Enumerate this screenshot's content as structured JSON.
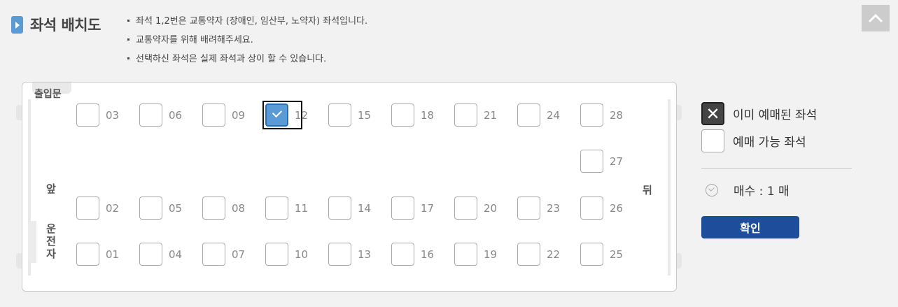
{
  "header": {
    "title": "좌석 배치도",
    "notices": [
      "좌석 1,2번은 교통약자 (장애인, 임산부, 노약자) 좌석입니다.",
      "교통약자를 위해 배려해주세요.",
      "선택하신 좌석은 실제 좌석과 상이 할 수 있습니다."
    ],
    "top_button_icon": "chevron-up-icon"
  },
  "bus": {
    "entrance_label": "출입문",
    "front_label": "앞",
    "back_label": "뒤",
    "driver_label": "운전자",
    "seats": [
      {
        "num": "03",
        "state": "available"
      },
      {
        "num": "06",
        "state": "available"
      },
      {
        "num": "09",
        "state": "available"
      },
      {
        "num": "12",
        "state": "selected"
      },
      {
        "num": "15",
        "state": "available"
      },
      {
        "num": "18",
        "state": "available"
      },
      {
        "num": "21",
        "state": "available"
      },
      {
        "num": "24",
        "state": "available"
      },
      {
        "num": "28",
        "state": "available"
      },
      {
        "num": "27",
        "state": "available"
      },
      {
        "num": "02",
        "state": "available"
      },
      {
        "num": "05",
        "state": "available"
      },
      {
        "num": "08",
        "state": "available"
      },
      {
        "num": "11",
        "state": "available"
      },
      {
        "num": "14",
        "state": "available"
      },
      {
        "num": "17",
        "state": "available"
      },
      {
        "num": "20",
        "state": "available"
      },
      {
        "num": "23",
        "state": "available"
      },
      {
        "num": "26",
        "state": "available"
      },
      {
        "num": "01",
        "state": "available"
      },
      {
        "num": "04",
        "state": "available"
      },
      {
        "num": "07",
        "state": "available"
      },
      {
        "num": "10",
        "state": "available"
      },
      {
        "num": "13",
        "state": "available"
      },
      {
        "num": "16",
        "state": "available"
      },
      {
        "num": "19",
        "state": "available"
      },
      {
        "num": "22",
        "state": "available"
      },
      {
        "num": "25",
        "state": "available"
      }
    ]
  },
  "legend": {
    "reserved_label": "이미 예매된 좌석",
    "available_label": "예매 가능 좌석"
  },
  "ticket_count": "매수 : 1 매",
  "confirm_label": "확인",
  "colors": {
    "selected": "#5b9bd5",
    "confirm_button": "#1e4d9b",
    "reserved": "#444444"
  }
}
